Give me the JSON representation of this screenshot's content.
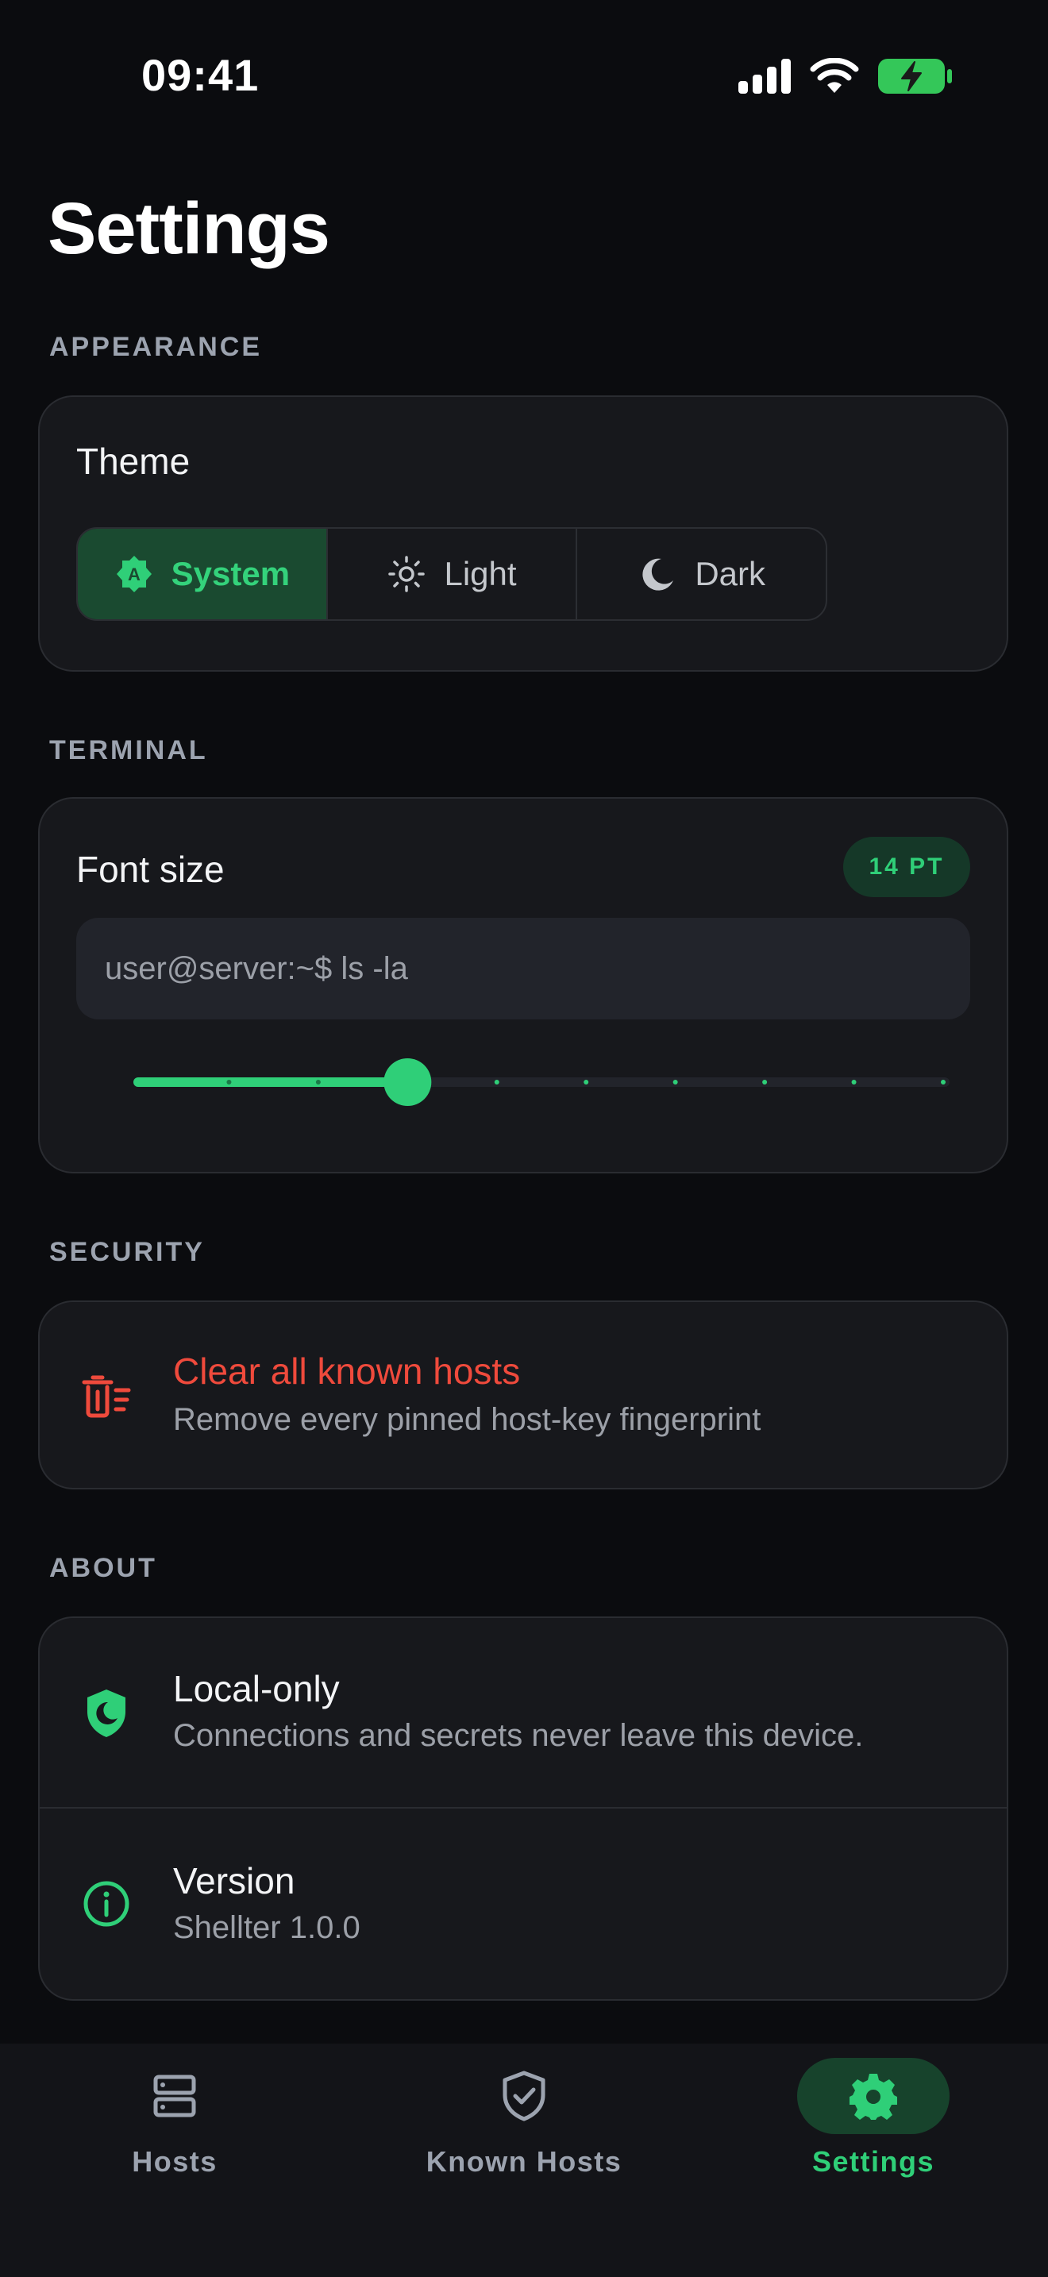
{
  "status_bar": {
    "time": "09:41"
  },
  "page": {
    "title": "Settings"
  },
  "appearance": {
    "section_label": "APPEARANCE",
    "theme_title": "Theme",
    "options": [
      {
        "label": "System",
        "icon": "auto-theme-icon",
        "selected": true
      },
      {
        "label": "Light",
        "icon": "sun-icon",
        "selected": false
      },
      {
        "label": "Dark",
        "icon": "moon-icon",
        "selected": false
      }
    ]
  },
  "terminal": {
    "section_label": "TERMINAL",
    "font_size_title": "Font size",
    "font_size_badge": "14 PT",
    "preview_text": "user@server:~$ ls -la",
    "slider": {
      "steps": 10,
      "selected_step": 4
    }
  },
  "security": {
    "section_label": "SECURITY",
    "clear_title": "Clear all known hosts",
    "clear_subtitle": "Remove every pinned host-key fingerprint"
  },
  "about": {
    "section_label": "ABOUT",
    "local_title": "Local-only",
    "local_subtitle": "Connections and secrets never leave this device.",
    "version_title": "Version",
    "version_subtitle": "Shellter 1.0.0"
  },
  "tabbar": {
    "tabs": [
      {
        "label": "Hosts",
        "icon": "server-icon",
        "active": false
      },
      {
        "label": "Known Hosts",
        "icon": "shield-check-icon",
        "active": false
      },
      {
        "label": "Settings",
        "icon": "gear-icon",
        "active": true
      }
    ]
  },
  "colors": {
    "accent": "#2fcf78",
    "danger": "#ef4a3c",
    "background": "#0b0c0f",
    "card": "#17181c"
  }
}
